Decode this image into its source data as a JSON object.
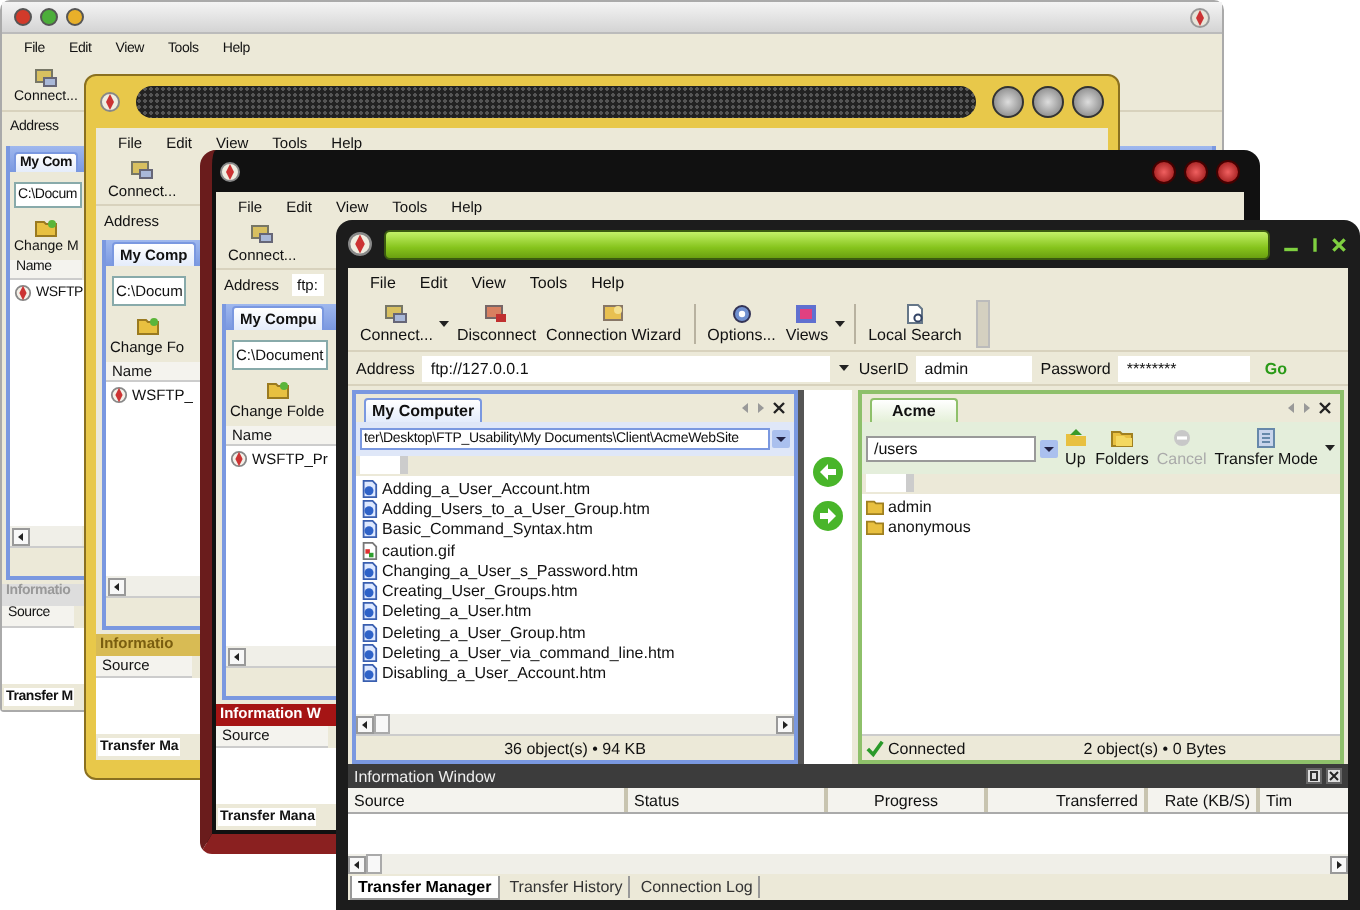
{
  "back_windows": [
    {
      "kind": "silver",
      "menu": [
        "File",
        "Edit",
        "View",
        "Tools",
        "Help"
      ],
      "connect_button": "Connect...",
      "address_label": "Address",
      "panel_tab": "My Com",
      "path": "C:\\Docum",
      "change_button": "Change M",
      "column": "Name",
      "file": "WSFTP",
      "info_title": "Informatio",
      "info_column": "Source",
      "info_tab": "Transfer M"
    },
    {
      "kind": "gold",
      "menu": [
        "File",
        "Edit",
        "View",
        "Tools",
        "Help"
      ],
      "connect_button": "Connect...",
      "address_label": "Address",
      "panel_tab": "My Comp",
      "path": "C:\\Docum",
      "change_button": "Change Fo",
      "column": "Name",
      "file": "WSFTP_",
      "info_title": "Informatio",
      "info_column": "Source",
      "info_tab": "Transfer Ma"
    },
    {
      "kind": "ruby",
      "menu": [
        "File",
        "Edit",
        "View",
        "Tools",
        "Help"
      ],
      "connect_button": "Connect...",
      "address_label": "Address",
      "address_value": "ftp:",
      "panel_tab": "My Compu",
      "path": "C:\\Document",
      "change_button": "Change Folde",
      "column": "Name",
      "file": "WSFTP_Pr",
      "info_title": "Information W",
      "info_column": "Source",
      "info_tab": "Transfer Mana"
    }
  ],
  "main_window": {
    "menu": [
      "File",
      "Edit",
      "View",
      "Tools",
      "Help"
    ],
    "toolbar": [
      {
        "kind": "connect",
        "label": "Connect...",
        "dropdown": true
      },
      {
        "kind": "disconnect",
        "label": "Disconnect",
        "dropdown": false
      },
      {
        "kind": "wizard",
        "label": "Connection Wizard",
        "dropdown": false
      },
      {
        "kind": "options",
        "label": "Options...",
        "dropdown": false
      },
      {
        "kind": "views",
        "label": "Views",
        "dropdown": true
      },
      {
        "kind": "search",
        "label": "Local Search",
        "dropdown": false
      }
    ],
    "address": {
      "label": "Address",
      "value": "ftp://127.0.0.1"
    },
    "user": {
      "label": "UserID",
      "value": "admin"
    },
    "password": {
      "label": "Password",
      "value": "********"
    },
    "go": "Go",
    "left_panel": {
      "tab": "My Computer",
      "path": "ter\\Desktop\\FTP_Usability\\My Documents\\Client\\AcmeWebSite",
      "files": [
        {
          "kind": "htm",
          "name": "Adding_a_User_Account.htm"
        },
        {
          "kind": "htm",
          "name": "Adding_Users_to_a_User_Group.htm"
        },
        {
          "kind": "htm",
          "name": "Basic_Command_Syntax.htm"
        },
        {
          "kind": "image",
          "name": "caution.gif"
        },
        {
          "kind": "htm",
          "name": "Changing_a_User_s_Password.htm"
        },
        {
          "kind": "htm",
          "name": "Creating_User_Groups.htm"
        },
        {
          "kind": "htm",
          "name": "Deleting_a_User.htm"
        },
        {
          "kind": "htm",
          "name": "Deleting_a_User_Group.htm"
        },
        {
          "kind": "htm",
          "name": "Deleting_a_User_via_command_line.htm"
        },
        {
          "kind": "htm",
          "name": "Disabling_a_User_Account.htm"
        }
      ],
      "status": "36 object(s) • 94 KB"
    },
    "right_panel": {
      "tab": "Acme",
      "path": "/users",
      "tools": [
        {
          "kind": "up",
          "label": "Up",
          "disabled": false
        },
        {
          "kind": "folders",
          "label": "Folders",
          "disabled": false
        },
        {
          "kind": "cancel",
          "label": "Cancel",
          "disabled": true
        },
        {
          "kind": "transfer",
          "label": "Transfer Mode",
          "disabled": false
        }
      ],
      "folders": [
        "admin",
        "anonymous"
      ],
      "connection": "Connected",
      "status": "2 object(s) • 0 Bytes"
    },
    "info_window": {
      "title": "Information Window",
      "columns": [
        "Source",
        "Status",
        "Progress",
        "Transferred",
        "Rate (KB/S)",
        "Tim"
      ],
      "tabs": [
        {
          "label": "Transfer Manager",
          "selected": true
        },
        {
          "label": "Transfer History",
          "selected": false
        },
        {
          "label": "Connection Log",
          "selected": false
        }
      ]
    }
  }
}
